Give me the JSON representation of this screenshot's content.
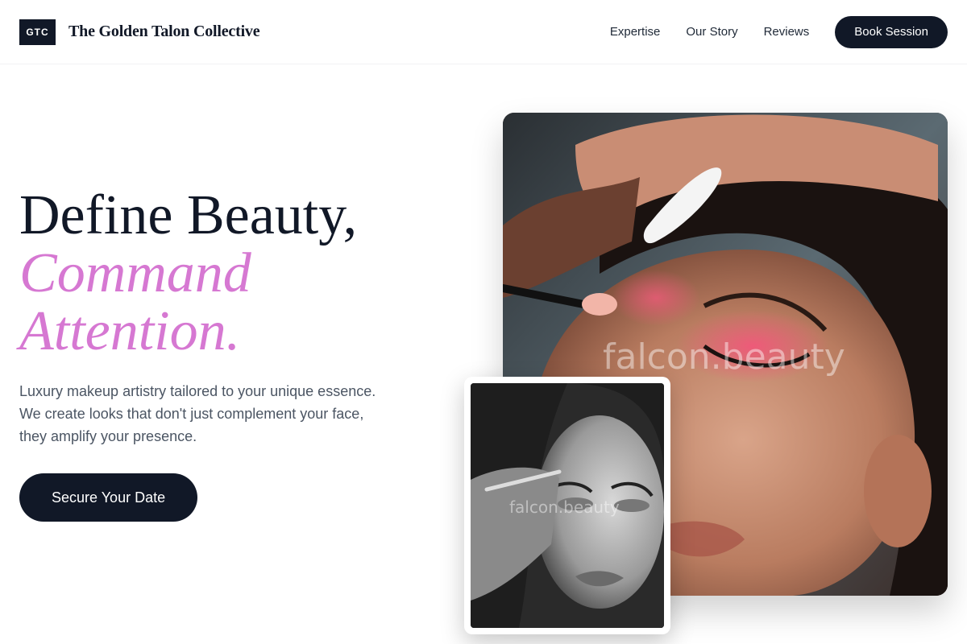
{
  "brand": {
    "logo_text": "GTC",
    "name": "The Golden Talon Collective"
  },
  "nav": {
    "links": [
      "Expertise",
      "Our Story",
      "Reviews"
    ],
    "cta_label": "Book Session"
  },
  "hero": {
    "title_line1": "Define Beauty,",
    "title_accent_line1": "Command",
    "title_accent_line2": "Attention.",
    "subtitle": "Luxury makeup artistry tailored to your unique essence. We create looks that don't just complement your face, they amplify your presence.",
    "cta_label": "Secure Your Date"
  },
  "images": {
    "main_watermark": "falcon.beauty",
    "inset_watermark": "falcon.beauty"
  },
  "colors": {
    "primary_dark": "#111827",
    "accent_pink": "#d678d2",
    "text_muted": "#4b5563"
  }
}
